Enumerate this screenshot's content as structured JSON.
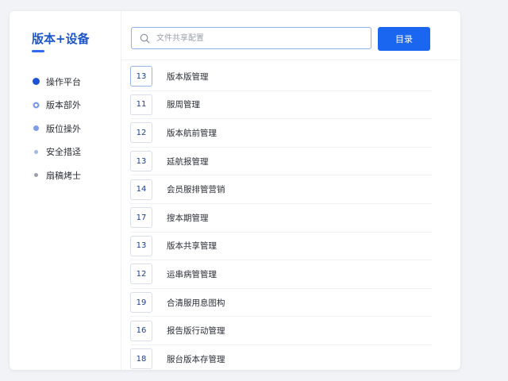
{
  "brand": {
    "title": "版本+设备"
  },
  "sidebar": {
    "items": [
      {
        "label": "操作平台",
        "dot": "d1"
      },
      {
        "label": "版本部外",
        "dot": "d2"
      },
      {
        "label": "版位操外",
        "dot": "d3"
      },
      {
        "label": "安全措迳",
        "dot": "d4"
      },
      {
        "label": "扇稿烤士",
        "dot": "d5"
      }
    ]
  },
  "search": {
    "placeholder": "文件共享配置"
  },
  "toolbar": {
    "button_label": "目录"
  },
  "list": {
    "rows": [
      {
        "num": "13",
        "label": "版本版管理"
      },
      {
        "num": "11",
        "label": "服周管理"
      },
      {
        "num": "12",
        "label": "版本航前管理"
      },
      {
        "num": "13",
        "label": "延航报管理"
      },
      {
        "num": "14",
        "label": "会员服排管营销"
      },
      {
        "num": "17",
        "label": "搜本期管理"
      },
      {
        "num": "13",
        "label": "版本共享管理"
      },
      {
        "num": "12",
        "label": "运串病管管理"
      },
      {
        "num": "19",
        "label": "合清服用息图构"
      },
      {
        "num": "16",
        "label": "报告版行动管理"
      },
      {
        "num": "18",
        "label": "服台版本存管理"
      }
    ]
  }
}
